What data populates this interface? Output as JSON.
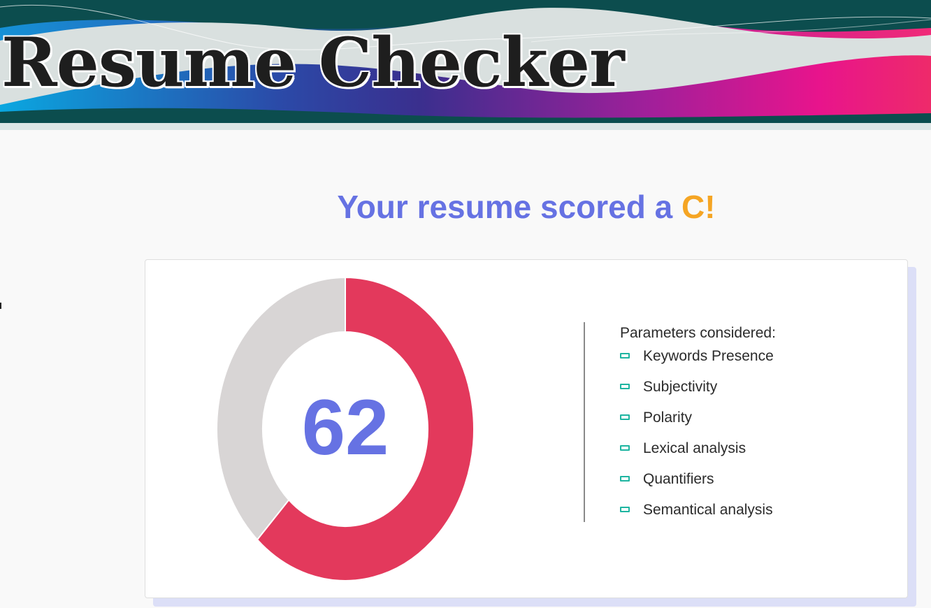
{
  "header": {
    "title": "Resume Checker"
  },
  "result": {
    "headline_prefix": "Your resume scored a ",
    "grade": "C",
    "headline_suffix": "!",
    "score": "62"
  },
  "chart_data": {
    "type": "pie",
    "subtype": "donut",
    "slices": [
      {
        "label": "",
        "value": 62,
        "color": "#e3395c"
      },
      {
        "label": "",
        "value": 38,
        "color": "#d8d5d5"
      }
    ],
    "center_label": "62"
  },
  "parameters": {
    "heading": "Parameters considered:",
    "items": [
      {
        "label": "Keywords Presence"
      },
      {
        "label": "Subjectivity"
      },
      {
        "label": "Polarity"
      },
      {
        "label": "Lexical analysis"
      },
      {
        "label": "Quantifiers"
      },
      {
        "label": "Semantical analysis"
      }
    ],
    "bullet_icon": "dash-icon",
    "bullet_color": "#1fb5a1"
  },
  "colors": {
    "accent": "#6672e3",
    "grade": "#f5a524",
    "score_ring": "#e3395c",
    "remainder_ring": "#d8d5d5"
  }
}
